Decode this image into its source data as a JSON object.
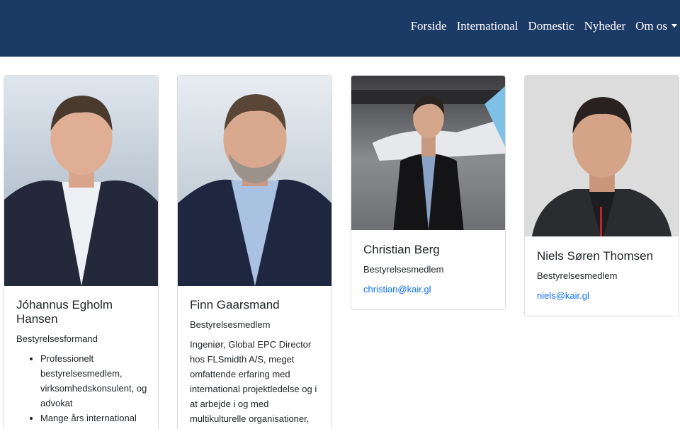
{
  "nav": {
    "items": [
      "Forside",
      "International",
      "Domestic",
      "Nyheder",
      "Om os"
    ]
  },
  "members": [
    {
      "name": "Jóhannus Egholm Hansen",
      "role": "Bestyrelsesformand",
      "bullets": [
        "Professionelt bestyrelsesmedlem, virksomhedskonsulent, og advokat",
        "Mange års international"
      ]
    },
    {
      "name": "Finn Gaarsmand",
      "role": "Bestyrelsesmedlem",
      "description": "Ingeniør, Global EPC Director hos FLSmidth A/S, meget omfattende erfaring med international projektledelse og i at arbejde i og med multikulturelle organisationer,"
    },
    {
      "name": "Christian Berg",
      "role": "Bestyrelsesmedlem",
      "email": "christian@kair.gl"
    },
    {
      "name": "Niels Søren Thomsen",
      "role": "Bestyrelsesmedlem",
      "email": "niels@kair.gl"
    }
  ],
  "colors": {
    "navbar": "#1c3a66",
    "link": "#0d6efd",
    "text": "#212529"
  }
}
